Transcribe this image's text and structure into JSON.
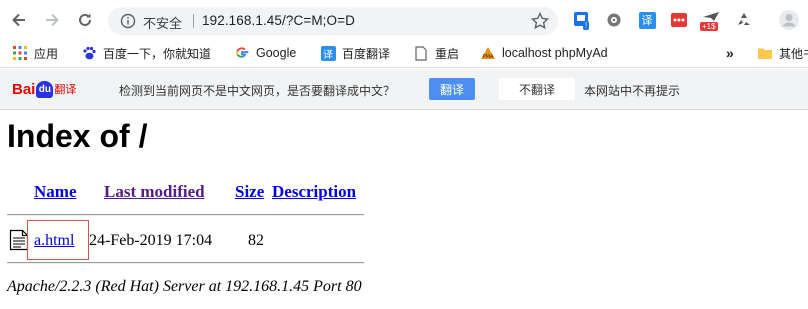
{
  "browser": {
    "omnibox": {
      "security_label": "不安全",
      "url": "192.168.1.45/?C=M;O=D"
    },
    "extensions": [
      {
        "name": "ext-blue-badge-icon",
        "badge": "!"
      },
      {
        "name": "ext-gear-icon"
      },
      {
        "name": "ext-translate-icon",
        "label": "译"
      },
      {
        "name": "ext-red-dots-icon"
      },
      {
        "name": "ext-plane-icon",
        "badge": "+1$"
      },
      {
        "name": "ext-recycle-icon"
      },
      {
        "name": "profile-avatar"
      }
    ]
  },
  "bookmarks": {
    "items": [
      {
        "label": "应用",
        "icon": "apps-grid-icon"
      },
      {
        "label": "百度一下，你就知道",
        "icon": "baidu-paw-icon"
      },
      {
        "label": "Google",
        "icon": "google-g-icon"
      },
      {
        "label": "百度翻译",
        "icon": "translate-icon"
      },
      {
        "label": "重启",
        "icon": "page-icon"
      },
      {
        "label": "localhost phpMyAd",
        "icon": "phpmyadmin-icon"
      }
    ],
    "overflow": "»",
    "other_folder": "其他书"
  },
  "translate_bar": {
    "logo_bai": "Bai",
    "logo_du": "du",
    "logo_fanyi": "翻译",
    "message": "检测到当前网页不是中文网页，是否要翻译成中文？",
    "translate_button": "翻译",
    "no_translate_button": "不翻译",
    "never_label": "本网站中不再提示"
  },
  "page": {
    "title": "Index of /",
    "columns": {
      "name": "Name",
      "last_modified": "Last modified",
      "size": "Size",
      "description": "Description"
    },
    "files": [
      {
        "name": "a.html",
        "modified": "24-Feb-2019 17:04",
        "size": "82",
        "description": ""
      }
    ],
    "footer": "Apache/2.2.3 (Red Hat) Server at 192.168.1.45 Port 80"
  },
  "colors": {
    "link": "#0000ee",
    "visited_link": "#551a8b",
    "translate_button": "#4c8ff0",
    "highlight_box": "#d9534f"
  }
}
